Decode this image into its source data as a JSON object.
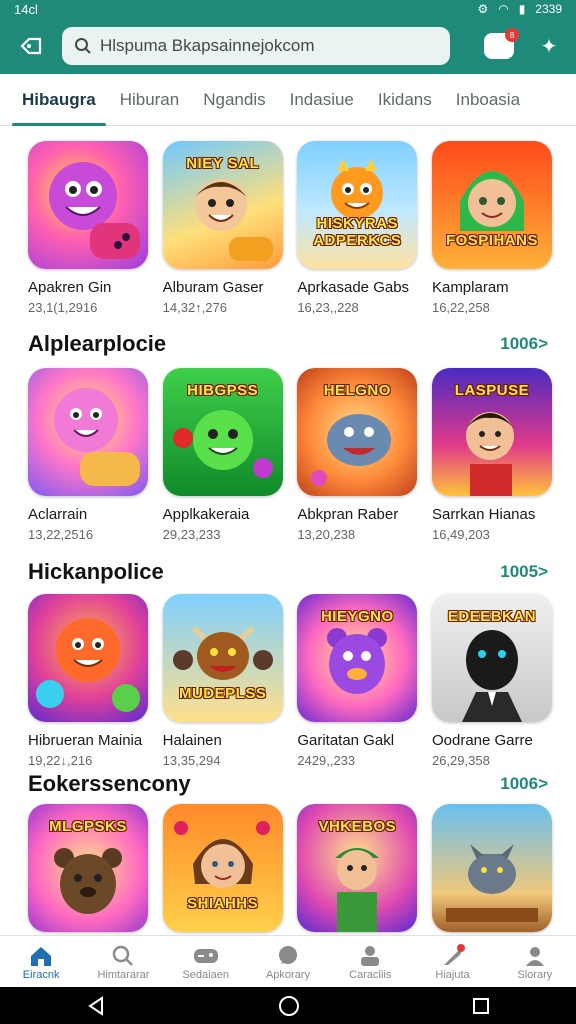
{
  "status": {
    "time": "14cl",
    "right_time": "2339"
  },
  "search": {
    "placeholder": "Hlspuma Bkapsainnejokcom"
  },
  "chat": {
    "badge": "8"
  },
  "tabs": [
    "Hibaugra",
    "Hiburan",
    "Ngandis",
    "Indasiue",
    "Ikidans",
    "Inboasia"
  ],
  "colors": {
    "accent": "#1f8a7a",
    "nav_active": "#1e6fb0"
  },
  "sections": [
    {
      "title": "",
      "more": "",
      "apps": [
        {
          "name": "Apakren Gin",
          "count": "23,1(1,2916",
          "caption": "",
          "icon": "purple-monster-gamepad-icon"
        },
        {
          "name": "Alburam Gaser",
          "count": "14,32↑,276",
          "caption": "NIEY SAL",
          "icon": "boy-gamepad-icon"
        },
        {
          "name": "Aprkasade Gabs",
          "count": "16,23,,228",
          "caption": "HISKYRAS ADPERKCS",
          "icon": "orange-dragon-icon"
        },
        {
          "name": "Kamplaram",
          "count": "16,22,258",
          "caption": "FOSPIHANS",
          "icon": "green-hair-girl-icon"
        }
      ]
    },
    {
      "title": "Alplearplocie",
      "more": "1006>",
      "apps": [
        {
          "name": "Aclarrain",
          "count": "13,22,2516",
          "caption": "",
          "icon": "pink-blob-gamepad-icon"
        },
        {
          "name": "Applkakeraia",
          "count": "29,23,233",
          "caption": "HIBGPSS",
          "icon": "green-blob-icon"
        },
        {
          "name": "Abkpran Raber",
          "count": "13,20,238",
          "caption": "HELGNO",
          "icon": "blue-beast-icon"
        },
        {
          "name": "Sarrkan Hianas",
          "count": "16,49,203",
          "caption": "LASPUSE",
          "icon": "hero-boy-icon"
        }
      ]
    },
    {
      "title": "Hickanpolice",
      "more": "1005>",
      "apps": [
        {
          "name": "Hibrueran Mainia",
          "count": "19,22↓,216",
          "caption": "",
          "icon": "orange-bubble-icon"
        },
        {
          "name": "Halainen",
          "count": "13,35,294",
          "caption": "MUDEPLSS",
          "icon": "bull-monster-icon"
        },
        {
          "name": "Garitatan Gakl",
          "count": "2429,,233",
          "caption": "HIEYGNO",
          "icon": "purple-bear-icon"
        },
        {
          "name": "Oodrane Garre",
          "count": "26,29,358",
          "caption": "EDEEBKAN",
          "icon": "panther-suit-icon"
        }
      ]
    },
    {
      "title": "Eokerssencony",
      "more": "1006>",
      "apps": [
        {
          "name": "",
          "count": "",
          "caption": "MLGPSKS",
          "icon": "brown-bear-icon"
        },
        {
          "name": "",
          "count": "",
          "caption": "SHIAHHS",
          "icon": "girl-hearts-icon"
        },
        {
          "name": "",
          "count": "",
          "caption": "VHKEBOS",
          "icon": "soldier-boy-icon"
        },
        {
          "name": "",
          "count": "",
          "caption": "",
          "icon": "wolf-icon"
        }
      ]
    }
  ],
  "bottom_nav": [
    {
      "label": "Eiracnk",
      "icon": "home-icon"
    },
    {
      "label": "Himtararar",
      "icon": "search-icon"
    },
    {
      "label": "Sedaiaen",
      "icon": "gamepad-icon"
    },
    {
      "label": "Apkorary",
      "icon": "chat-icon"
    },
    {
      "label": "Caracliis",
      "icon": "games-icon"
    },
    {
      "label": "Hiajuta",
      "icon": "feather-icon"
    },
    {
      "label": "Slorary",
      "icon": "profile-icon"
    }
  ]
}
